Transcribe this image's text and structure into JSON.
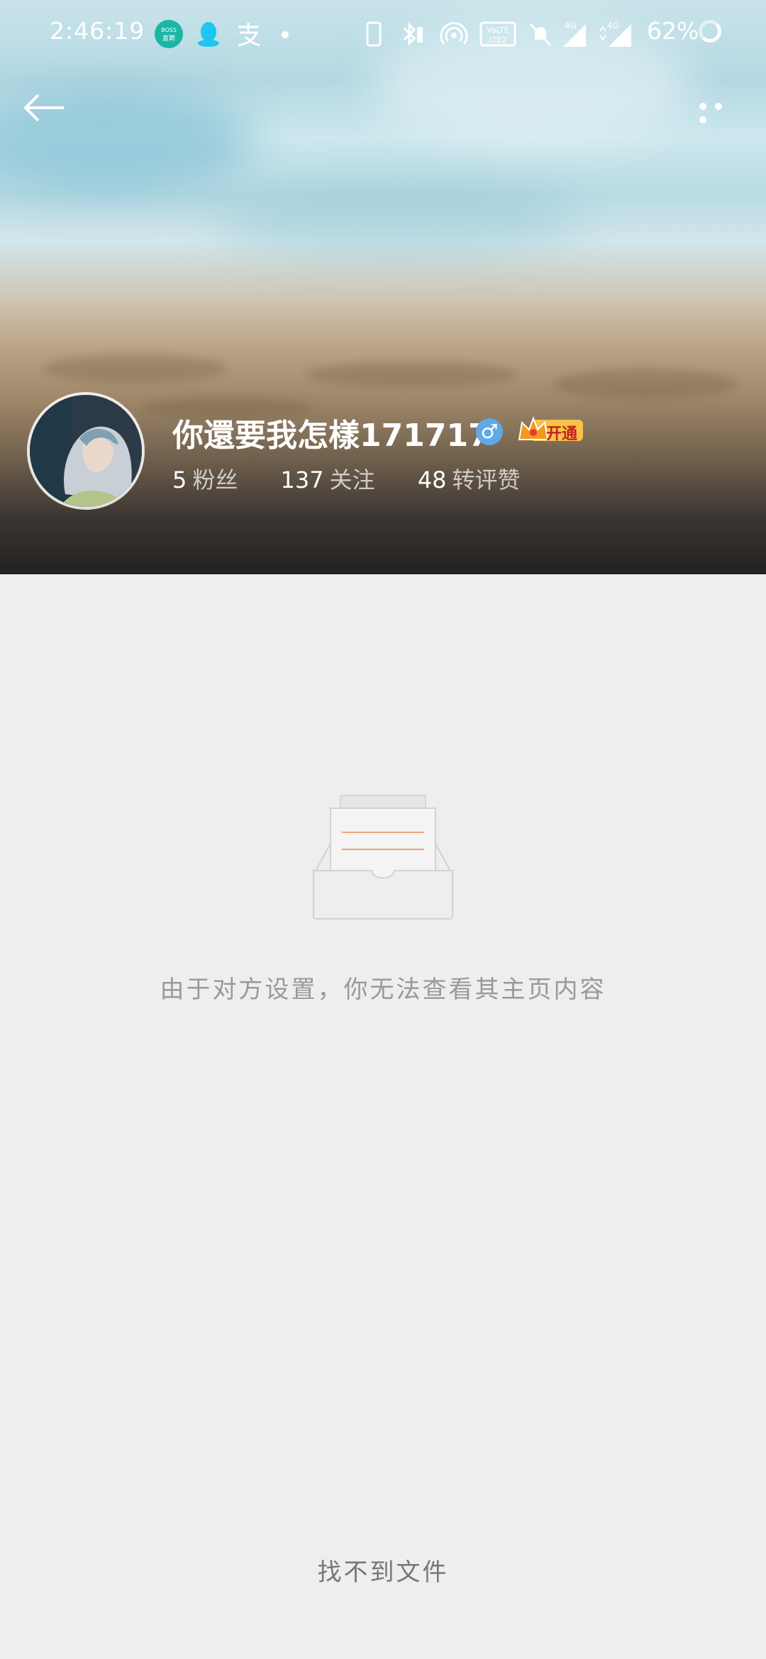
{
  "status_bar": {
    "time": "2:46:19",
    "battery": "62%",
    "apps": [
      "boss-zhipin-icon",
      "qq-icon",
      "alipay-icon"
    ],
    "indicators": [
      "phone-icon",
      "bluetooth-icon",
      "hotspot-icon",
      "volte-icon",
      "mute-bell-icon",
      "signal-4g-icon",
      "signal-4g-icon"
    ]
  },
  "header": {
    "back_icon": "back-arrow-icon",
    "more_icon": "more-dots-icon"
  },
  "profile": {
    "name": "你還要我怎樣171717",
    "gender_symbol": "♂",
    "vip_label": "开通",
    "stats": [
      {
        "value": "5",
        "label": "粉丝"
      },
      {
        "value": "137",
        "label": "关注"
      },
      {
        "value": "48",
        "label": "转评赞"
      }
    ]
  },
  "content": {
    "empty_message": "由于对方设置，你无法查看其主页内容",
    "footer": "找不到文件"
  },
  "colors": {
    "background": "#eeeeee",
    "accent_line": "#f3a27b",
    "gender_blue": "#5fa9e6",
    "vip_gold": "#f6c24a"
  }
}
